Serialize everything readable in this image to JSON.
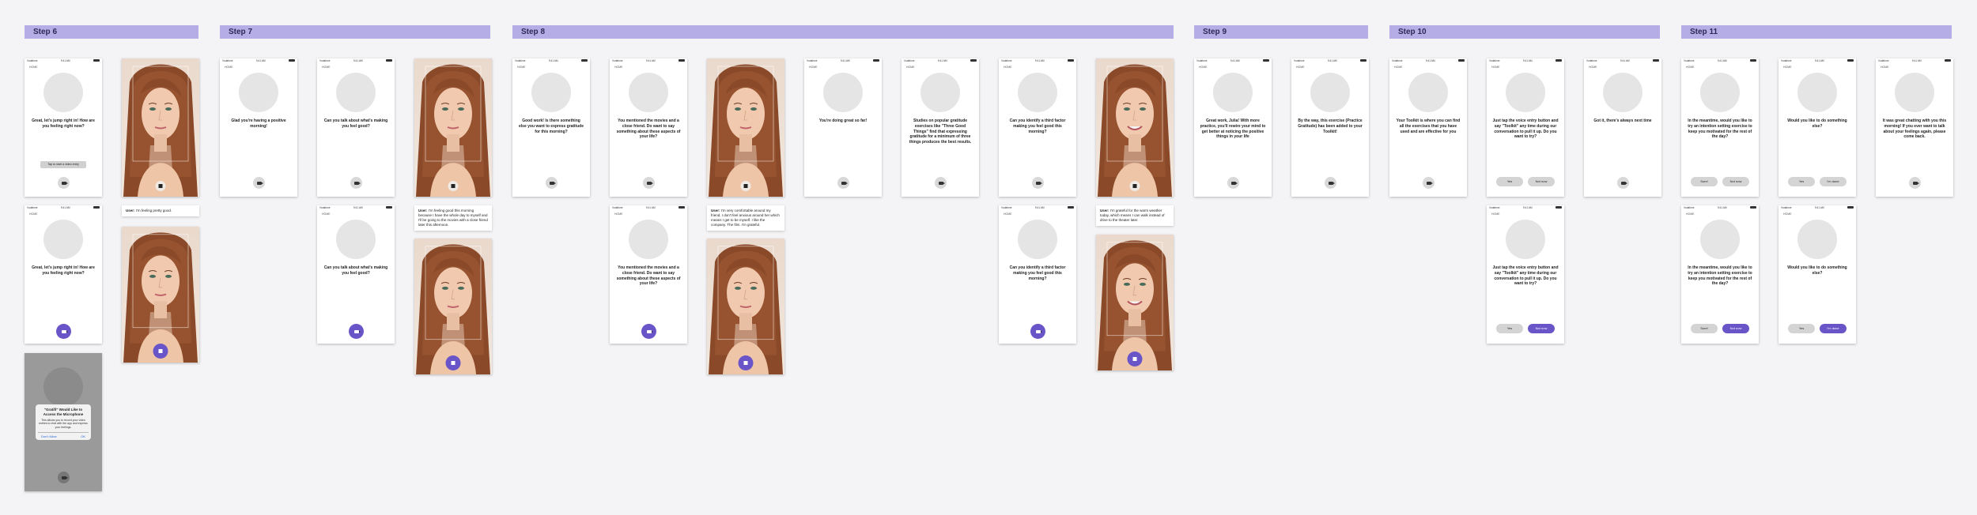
{
  "steps": [
    "Step 6",
    "Step 7",
    "Step 8",
    "Step 9",
    "Step 10",
    "Step 11"
  ],
  "status": {
    "carrier": "Vodafone",
    "time": "9:41 AM",
    "battery": "100%"
  },
  "home_label": "HOME",
  "messages": {
    "s6a": "Great, let's jump right in! How are you feeling right now?",
    "s6b": "Great, let's jump right in! How are you feeling right now?",
    "s7a": "Glad you're having a positive morning!",
    "s7b": "Can you talk about what's making you feel good?",
    "s7c": "Can you talk about what's making you feel good?",
    "s8a": "Good work! Is there something else you want to express gratitude for this morning?",
    "s8b": "You mentioned the movies and a close friend. Do want to say something about these aspects of your life?",
    "s8c": "You mentioned the movies and a close friend. Do want to say something about these aspects of your life?",
    "s8d": "You're doing great so far!",
    "s8e": "Studies on popular gratitude exercises like \"Three Good Things\" find that expressing gratitude for a minimum of three things produces the best results.",
    "s8f": "Can you identify a third factor making you feel good this morning?",
    "s8g": "Can you identify a third factor making you feel good this morning?",
    "s9a": "Great work, Julia! With more practice, you'll rewire your mind to get better at noticing the positive things in your life",
    "s9b": "By the way, this exercise (Practice Gratitude) has been added to your Toolkit!",
    "s10a": "Your Toolkit is where you can find all the exercises that you have used and are effective for you",
    "s10b": "Just tap the voice entry button and say \"Toolkit\" any time during our conversation to pull it up. Do you want to try?",
    "s10c": "Just tap the voice entry button and say \"Toolkit\" any time during our conversation to pull it up. Do you want to try?",
    "s10d": "Got it, there's always next time",
    "s11a": "In the meantime, would you like to try an intention setting exercise to keep you motivated for the rest of the day?",
    "s11b": "In the meantime, would you like to try an intention setting exercise to keep you motivated for the rest of the day?",
    "s11c": "Would you like to do something else?",
    "s11d": "Would you like to do something else?",
    "s11e": "It was great chatting with you this morning! If you ever want to talk about your feelings again, please come back."
  },
  "buttons": {
    "tap_to_record": "Tap to start a video entry",
    "yes": "Yes",
    "not_now": "Not now",
    "sure": "Sure!",
    "im_done": "I'm done"
  },
  "chats": {
    "c6": {
      "speaker": "User:",
      "text": "I'm feeling pretty good."
    },
    "c7": {
      "speaker": "User:",
      "text": "I'm feeling good this morning because I have the whole day to myself and I'll be going to the movies with a close friend later this afternoon."
    },
    "c8a": {
      "speaker": "User:",
      "text": "I'm very comfortable around my friend. I don't feel anxious around her which means I get to be myself. I like the company. The film. I'm grateful."
    },
    "c8b": {
      "speaker": "User:",
      "text": "I'm grateful for the warm weather today, which means I can walk instead of drive to the theater later."
    }
  },
  "dialog": {
    "title": "\"Gratifi\" Would Like to Access the Microphone",
    "body": "This allows you to record your video entries to chat with the app and express your feelings.",
    "deny": "Don't Allow",
    "ok": "OK"
  },
  "colors": {
    "accent": "#6a55c8",
    "header": "#b5aee6"
  }
}
